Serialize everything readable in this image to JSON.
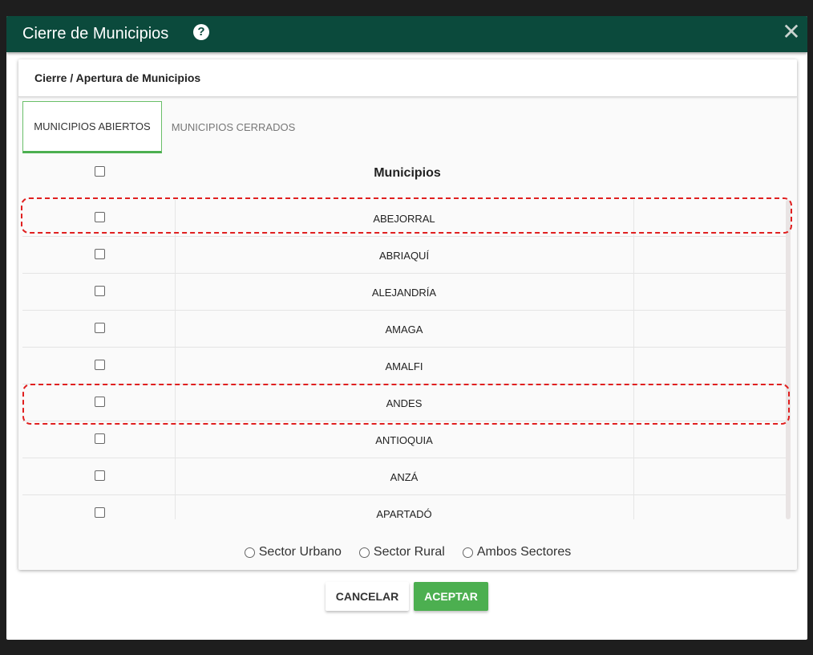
{
  "modal": {
    "title": "Cierre de Municipios",
    "help_icon": "?",
    "close_icon": "✕"
  },
  "card": {
    "title": "Cierre / Apertura de Municipios"
  },
  "tabs": [
    {
      "label": "MUNICIPIOS ABIERTOS",
      "active": true
    },
    {
      "label": "MUNICIPIOS CERRADOS",
      "active": false
    }
  ],
  "table": {
    "column_header": "Municipios",
    "rows": [
      "ABEJORRAL",
      "ABRIAQUÍ",
      "ALEJANDRÍA",
      "AMAGA",
      "AMALFI",
      "ANDES",
      "ANTIOQUIA",
      "ANZÁ",
      "APARTADÓ"
    ],
    "highlighted_rows": [
      "ABEJORRAL",
      "ANDES"
    ]
  },
  "sectors": [
    {
      "label": "Sector Urbano"
    },
    {
      "label": "Sector Rural"
    },
    {
      "label": "Ambos Sectores"
    }
  ],
  "buttons": {
    "cancel": "CANCELAR",
    "accept": "ACEPTAR"
  },
  "colors": {
    "header_bg": "#0b4a3c",
    "accent_green": "#4caf50",
    "highlight_red": "#e02020"
  }
}
